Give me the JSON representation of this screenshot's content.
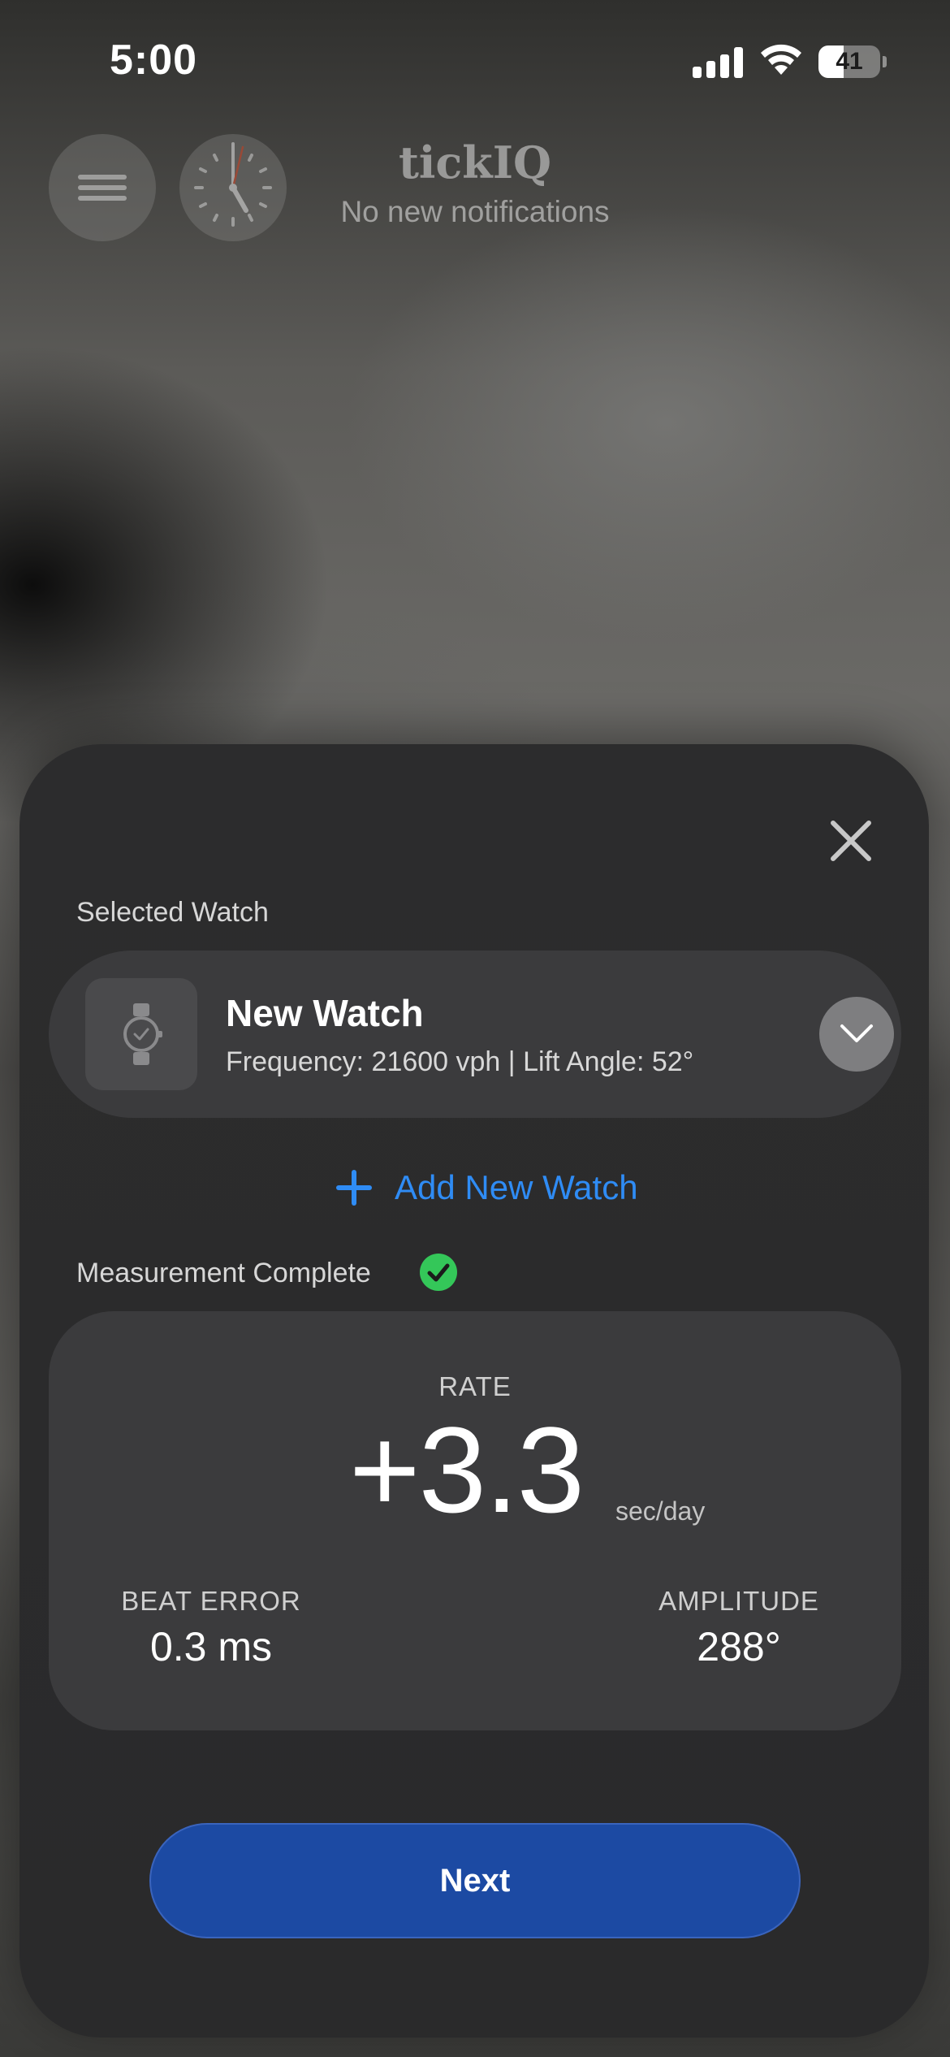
{
  "status_bar": {
    "time": "5:00",
    "battery_percent": "41",
    "battery_level": 0.41,
    "signal_icon": "cellular-signal-icon",
    "wifi_icon": "wifi-icon"
  },
  "header": {
    "app_title": "tickIQ",
    "notification_text": "No new notifications",
    "menu_icon": "hamburger-menu-icon",
    "clock_icon": "analog-clock-icon"
  },
  "sheet": {
    "close_icon": "close-icon",
    "selected_watch_label": "Selected Watch",
    "watch": {
      "name": "New Watch",
      "specs": "Frequency: 21600 vph | Lift Angle: 52°",
      "thumbnail_icon": "wristwatch-icon",
      "dropdown_icon": "chevron-down-icon"
    },
    "add_watch_label": "Add New Watch",
    "add_watch_icon": "plus-icon",
    "measurement_status": "Measurement Complete",
    "status_icon": "checkmark-circle-icon",
    "results": {
      "rate_label": "RATE",
      "rate_value": "+3.3",
      "rate_unit": "sec/day",
      "beat_error_label": "BEAT ERROR",
      "beat_error_value": "0.3 ms",
      "amplitude_label": "AMPLITUDE",
      "amplitude_value": "288°"
    },
    "next_label": "Next"
  },
  "colors": {
    "accent_blue": "#2f8cf5",
    "next_button": "#1c4aa3",
    "success_green": "#34c759",
    "sheet_background": "#2c2c2d",
    "card_background": "#3b3b3d"
  }
}
